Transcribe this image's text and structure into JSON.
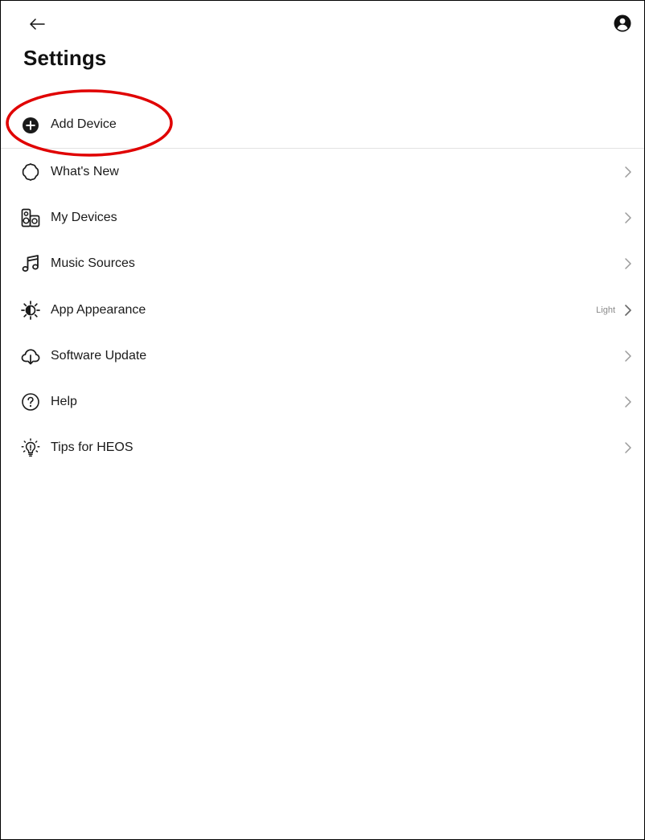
{
  "header": {
    "title": "Settings",
    "back_icon": "arrow-left-icon",
    "account_icon": "account-icon"
  },
  "add_device": {
    "label": "Add Device",
    "icon": "plus-circle-icon",
    "highlighted": true,
    "highlight_color": "#e00000"
  },
  "menu": {
    "items": [
      {
        "label": "What's New",
        "icon": "badge-outline-icon",
        "value": ""
      },
      {
        "label": "My Devices",
        "icon": "speakers-icon",
        "value": ""
      },
      {
        "label": "Music Sources",
        "icon": "music-note-icon",
        "value": ""
      },
      {
        "label": "App Appearance",
        "icon": "appearance-icon",
        "value": "Light"
      },
      {
        "label": "Software Update",
        "icon": "cloud-download-icon",
        "value": ""
      },
      {
        "label": "Help",
        "icon": "help-circle-icon",
        "value": ""
      },
      {
        "label": "Tips for HEOS",
        "icon": "lightbulb-icon",
        "value": ""
      }
    ]
  },
  "colors": {
    "text": "#1a1a1a",
    "secondary_text": "#8a8a8a",
    "chevron": "#9a9a9a",
    "divider": "#e3e3e3",
    "highlight": "#e00000"
  }
}
